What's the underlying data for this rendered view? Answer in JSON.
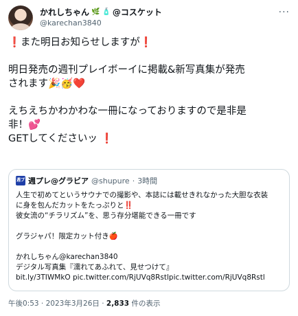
{
  "author": {
    "display_name": "かれしちゃん",
    "name_suffix": "@コスケット",
    "username": "@karechan3840"
  },
  "body": {
    "lines": [
      "❗️また明日お知らせしますが❗️",
      "",
      "明日発売の週刊プレイボーイに掲載&新写真集が発売",
      "されます🎉🥳❤️",
      "",
      "えちえちかわかわな一冊になっておりますので是非是",
      "非！💕",
      "GETしてくださいッ ❗️"
    ]
  },
  "quote": {
    "avatar_label": "週プレ",
    "display_name": "週プレ@グラビア",
    "username": "@shupure",
    "separator": "·",
    "time": "3時間",
    "lines": [
      "人生で初めてというサウナでの撮影や、本誌には載せきれなかった大胆な衣装",
      "に身を包んだカットをたっぷりと‼️",
      "彼女流の“チラリズム”を、思う存分堪能できる一冊です",
      "",
      "グラジャパ！限定カット付き🍎",
      "",
      "かれしちゃん@karechan3840",
      "デジタル写真集『濡れてあふれて、見せつけて』",
      "bit.ly/3TIWMkO pic.twitter.com/RjUVq8Rstlpic.twitter.com/RjUVq8Rstl"
    ]
  },
  "meta": {
    "time": "午後0:53",
    "sep1": " · ",
    "date": "2023年3月26日",
    "sep2": " · ",
    "views_count": "2,833",
    "views_label": " 件の表示"
  }
}
